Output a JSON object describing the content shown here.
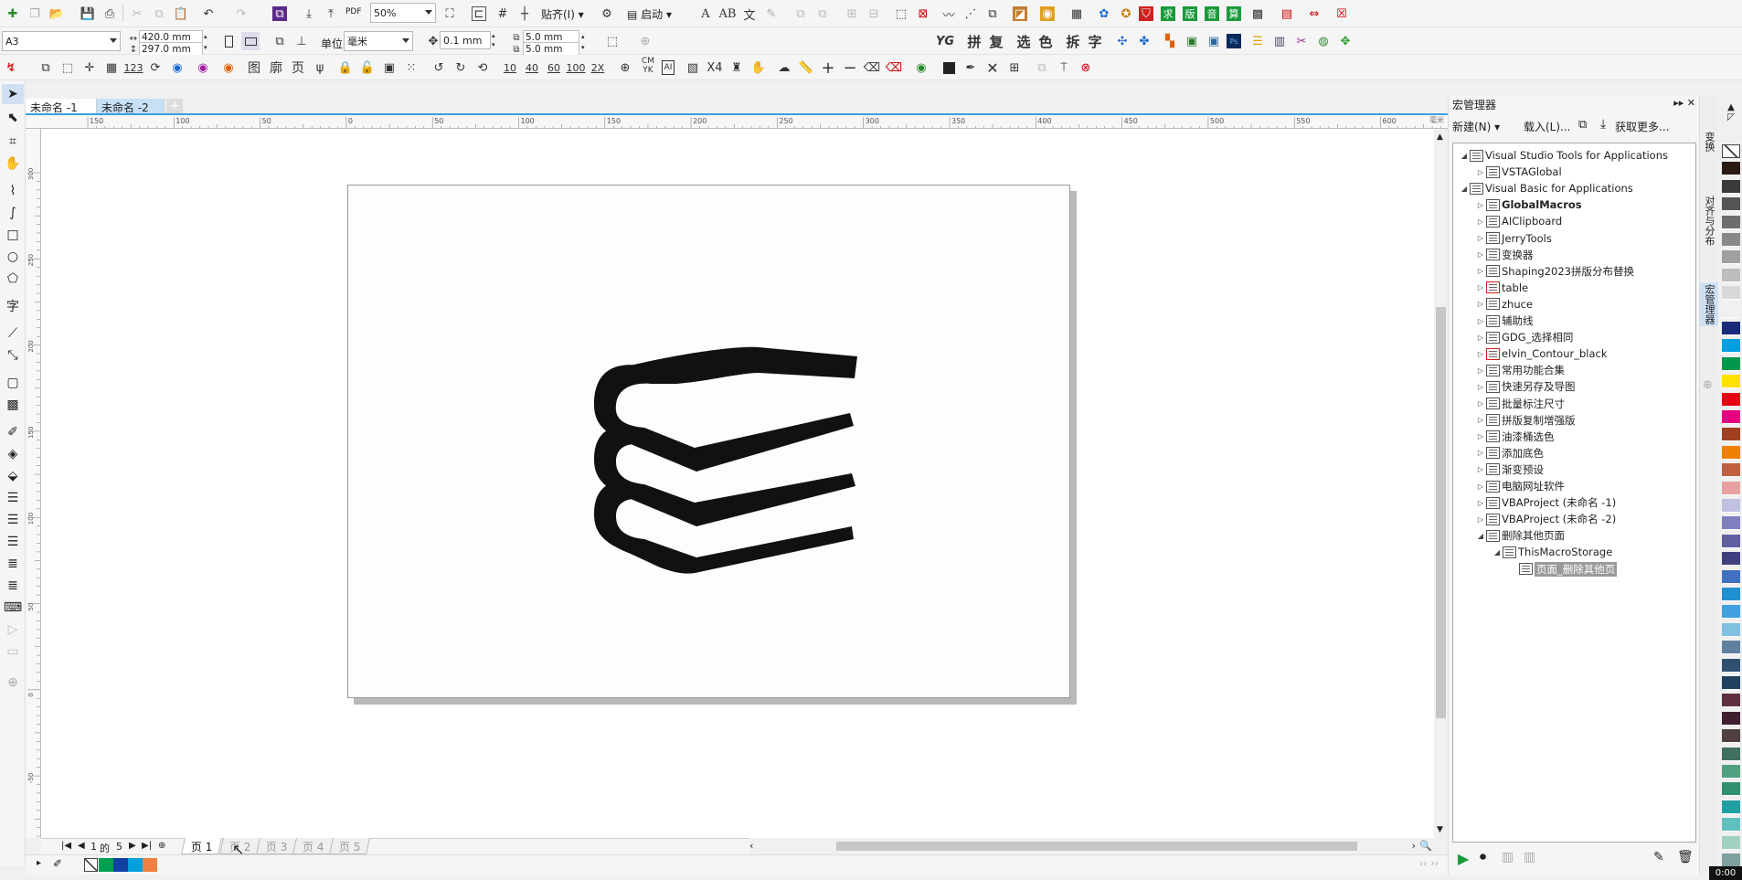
{
  "toolbar1": {
    "zoom": "50%",
    "snap_label": "贴齐(I)",
    "launch_label": "启动",
    "pdf_label": "PDF",
    "text_tools": [
      "拼",
      "复",
      "选",
      "色",
      "拆",
      "字"
    ]
  },
  "propbar": {
    "page_size": "A3",
    "width": "420.0 mm",
    "height": "297.0 mm",
    "unit_label": "单位:",
    "unit_value": "毫米",
    "nudge": "0.1 mm",
    "dup_x": "5.0 mm",
    "dup_y": "5.0 mm"
  },
  "toolbar3": {
    "text_buttons": [
      "图",
      "廓",
      "页"
    ],
    "number_buttons": [
      "10",
      "40",
      "60",
      "100",
      "2X"
    ],
    "cmyk": "CM YK",
    "x4": "X4"
  },
  "doc_tabs": [
    "未命名 -1",
    "未命名 -2"
  ],
  "ruler": {
    "h_labels": [
      "150",
      "100",
      "50",
      "0",
      "50",
      "100",
      "150",
      "200",
      "250",
      "300",
      "350",
      "400",
      "450",
      "500",
      "550",
      "600"
    ],
    "unit": "毫米",
    "v_labels": [
      "300",
      "250",
      "200",
      "150",
      "100",
      "50",
      "0",
      "-50"
    ]
  },
  "page_nav": {
    "current": "1",
    "of_label": "的",
    "total": "5",
    "tabs": [
      "页 1",
      "页 2",
      "页 3",
      "页 4",
      "页 5"
    ]
  },
  "macro_panel": {
    "title": "宏管理器",
    "new_label": "新建(N)",
    "load_label": "载入(L)...",
    "get_more_label": "获取更多...",
    "tree": [
      {
        "label": "Visual Studio Tools for Applications",
        "level": 0,
        "expanded": true
      },
      {
        "label": "VSTAGlobal",
        "level": 1,
        "expanded": false
      },
      {
        "label": "Visual Basic for Applications",
        "level": 0,
        "expanded": true
      },
      {
        "label": "GlobalMacros",
        "level": 1,
        "expanded": false,
        "bold": true
      },
      {
        "label": "AIClipboard",
        "level": 1,
        "expanded": false
      },
      {
        "label": "JerryTools",
        "level": 1,
        "expanded": false
      },
      {
        "label": "变换器",
        "level": 1,
        "expanded": false
      },
      {
        "label": "Shaping2023拼版分布替换",
        "level": 1,
        "expanded": false
      },
      {
        "label": "table",
        "level": 1,
        "expanded": false,
        "locked": true
      },
      {
        "label": "zhuce",
        "level": 1,
        "expanded": false
      },
      {
        "label": "辅助线",
        "level": 1,
        "expanded": false
      },
      {
        "label": "GDG_选择相同",
        "level": 1,
        "expanded": false
      },
      {
        "label": "elvin_Contour_black",
        "level": 1,
        "expanded": false,
        "locked": true
      },
      {
        "label": "常用功能合集",
        "level": 1,
        "expanded": false
      },
      {
        "label": "快速另存及导图",
        "level": 1,
        "expanded": false
      },
      {
        "label": "批量标注尺寸",
        "level": 1,
        "expanded": false
      },
      {
        "label": "拼版复制增强版",
        "level": 1,
        "expanded": false
      },
      {
        "label": "油漆桶选色",
        "level": 1,
        "expanded": false
      },
      {
        "label": "添加底色",
        "level": 1,
        "expanded": false
      },
      {
        "label": "渐变预设",
        "level": 1,
        "expanded": false
      },
      {
        "label": "电脑网址软件",
        "level": 1,
        "expanded": false
      },
      {
        "label": "VBAProject (未命名 -1)",
        "level": 1,
        "expanded": false
      },
      {
        "label": "VBAProject (未命名 -2)",
        "level": 1,
        "expanded": false
      },
      {
        "label": "删除其他页面",
        "level": 1,
        "expanded": true
      },
      {
        "label": "ThisMacroStorage",
        "level": 2,
        "expanded": true
      },
      {
        "label": "页面_删除其他页",
        "level": 3,
        "selected": true
      }
    ]
  },
  "docker_tabs": [
    "变换",
    "对齐与分布",
    "宏管理器"
  ],
  "palette": [
    "#ffffff",
    "#2b1a14",
    "#3a3a3a",
    "#555555",
    "#6e6e6e",
    "#888888",
    "#a0a0a0",
    "#bdbdbd",
    "#d8d8d8",
    "#f0f0f0",
    "#1a2a7a",
    "#00a0e0",
    "#00964b",
    "#ffe100",
    "#e60012",
    "#e4007f",
    "#a04020",
    "#f08000",
    "#c06040",
    "#e8a0a0",
    "#c0c0e0",
    "#8080c0",
    "#6060a0",
    "#404080",
    "#4070c0",
    "#2090d0",
    "#40a0e0",
    "#80c0e0",
    "#6080a0",
    "#305070",
    "#204060",
    "#603040",
    "#402030",
    "#504040",
    "#407060",
    "#50a080",
    "#309070",
    "#20a0a0",
    "#60c0c0",
    "#a0d0c0",
    "#80a0a0"
  ],
  "statusbar": {
    "clock": "0:00",
    "swatches": [
      "#00a050",
      "#1040a0",
      "#00a0e0",
      "#f08040"
    ]
  }
}
